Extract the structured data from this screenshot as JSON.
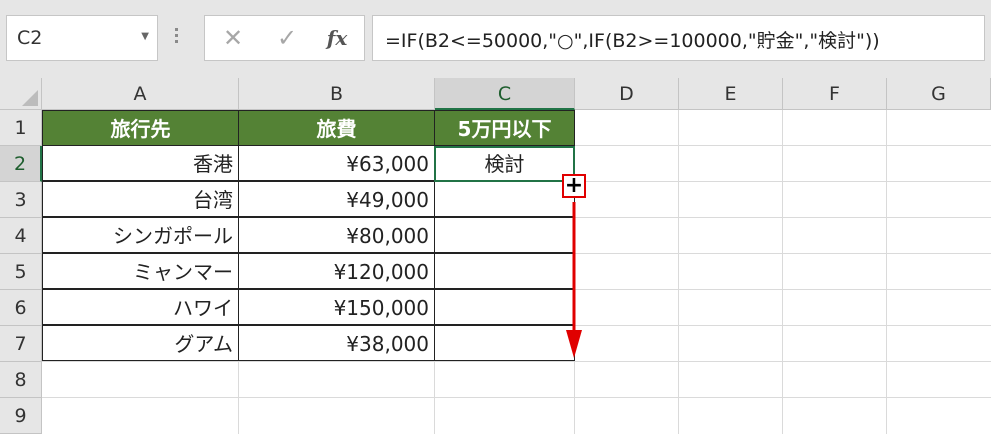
{
  "namebox": {
    "value": "C2"
  },
  "formula_bar": {
    "cancel_glyph": "✕",
    "enter_glyph": "✓",
    "fx_label": "fx",
    "formula": "=IF(B2<=50000,\"○\",IF(B2>=100000,\"貯金\",\"検討\"))"
  },
  "columns": [
    "A",
    "B",
    "C",
    "D",
    "E",
    "F",
    "G"
  ],
  "rows": [
    "1",
    "2",
    "3",
    "4",
    "5",
    "6",
    "7",
    "8",
    "9"
  ],
  "selected": {
    "column": "C",
    "row": "2"
  },
  "table": {
    "headers": [
      "旅行先",
      "旅費",
      "5万円以下"
    ],
    "rows": [
      [
        "香港",
        "¥63,000",
        "検討"
      ],
      [
        "台湾",
        "¥49,000",
        ""
      ],
      [
        "シンガポール",
        "¥80,000",
        ""
      ],
      [
        "ミャンマー",
        "¥120,000",
        ""
      ],
      [
        "ハワイ",
        "¥150,000",
        ""
      ],
      [
        "グアム",
        "¥38,000",
        ""
      ]
    ]
  },
  "icons": {
    "namebox_dropdown": "triangle-down",
    "fill_handle": "plus-cross-cursor",
    "drag_arrow": "arrow-down"
  },
  "colors": {
    "header_fill": "#548235",
    "selection": "#217346",
    "annotation": "#e00000"
  }
}
